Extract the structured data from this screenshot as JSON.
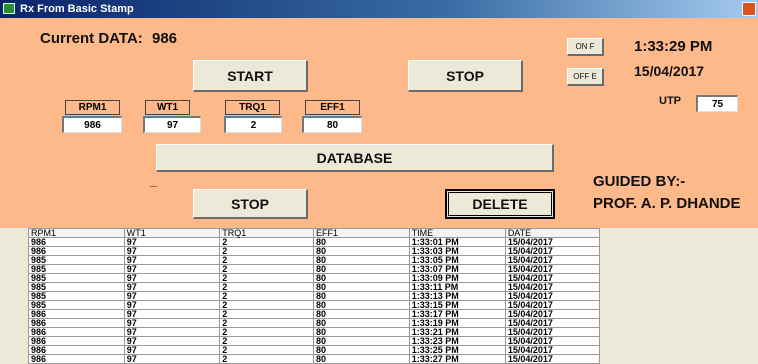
{
  "window": {
    "title": "Rx From Basic Stamp"
  },
  "current": {
    "label": "Current DATA:",
    "value": "986"
  },
  "controls": {
    "start": "START",
    "stop_top": "STOP",
    "database": "DATABASE",
    "stop_bottom": "STOP",
    "delete": "DELETE",
    "on_label": "ON F",
    "off_label": "OFF E",
    "dash": "_"
  },
  "clock": {
    "time": "1:33:29 PM",
    "date": "15/04/2017"
  },
  "utp": {
    "label": "UTP",
    "value": "75"
  },
  "params": [
    {
      "label": "RPM1",
      "value": "986"
    },
    {
      "label": "WT1",
      "value": "97"
    },
    {
      "label": "TRQ1",
      "value": "2"
    },
    {
      "label": "EFF1",
      "value": "80"
    }
  ],
  "guide": {
    "line1": "GUIDED BY:-",
    "line2": "PROF. A. P. DHANDE"
  },
  "table": {
    "headers": [
      "RPM1",
      "WT1",
      "TRQ1",
      "EFF1",
      "TIME",
      "DATE"
    ],
    "rows": [
      [
        "986",
        "97",
        "2",
        "80",
        "1:33:01 PM",
        "15/04/2017"
      ],
      [
        "986",
        "97",
        "2",
        "80",
        "1:33:03 PM",
        "15/04/2017"
      ],
      [
        "985",
        "97",
        "2",
        "80",
        "1:33:05 PM",
        "15/04/2017"
      ],
      [
        "985",
        "97",
        "2",
        "80",
        "1:33:07 PM",
        "15/04/2017"
      ],
      [
        "985",
        "97",
        "2",
        "80",
        "1:33:09 PM",
        "15/04/2017"
      ],
      [
        "985",
        "97",
        "2",
        "80",
        "1:33:11 PM",
        "15/04/2017"
      ],
      [
        "985",
        "97",
        "2",
        "80",
        "1:33:13 PM",
        "15/04/2017"
      ],
      [
        "985",
        "97",
        "2",
        "80",
        "1:33:15 PM",
        "15/04/2017"
      ],
      [
        "986",
        "97",
        "2",
        "80",
        "1:33:17 PM",
        "15/04/2017"
      ],
      [
        "986",
        "97",
        "2",
        "80",
        "1:33:19 PM",
        "15/04/2017"
      ],
      [
        "986",
        "97",
        "2",
        "80",
        "1:33:21 PM",
        "15/04/2017"
      ],
      [
        "986",
        "97",
        "2",
        "80",
        "1:33:23 PM",
        "15/04/2017"
      ],
      [
        "986",
        "97",
        "2",
        "80",
        "1:33:25 PM",
        "15/04/2017"
      ],
      [
        "986",
        "97",
        "2",
        "80",
        "1:33:27 PM",
        "15/04/2017"
      ]
    ]
  },
  "colors": {
    "form_bg": "#fdb98a",
    "button_bg": "#ece9d8",
    "title_bar": "#0a246a"
  }
}
